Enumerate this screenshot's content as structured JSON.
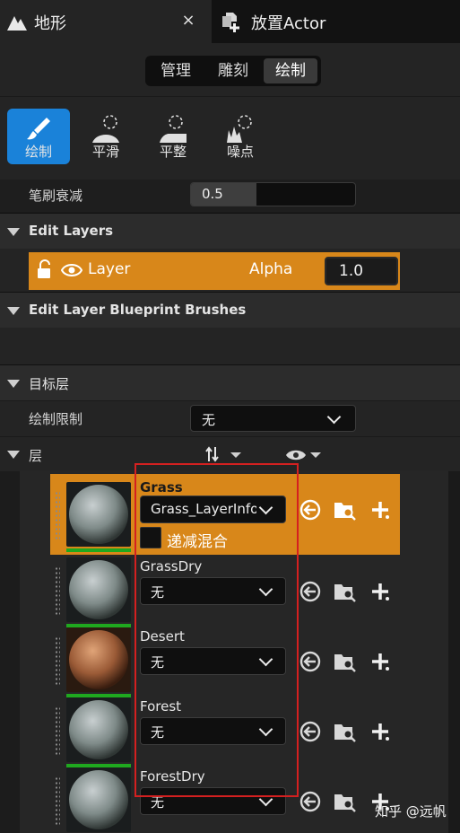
{
  "tabs": [
    {
      "title": "地形",
      "close": "×"
    },
    {
      "title": "放置Actor"
    }
  ],
  "modes": [
    "管理",
    "雕刻",
    "绘制"
  ],
  "active_mode": "绘制",
  "tools": [
    {
      "label": "绘制",
      "active": true
    },
    {
      "label": "平滑",
      "active": false
    },
    {
      "label": "平整",
      "active": false
    },
    {
      "label": "噪点",
      "active": false
    }
  ],
  "brush_falloff": {
    "label": "笔刷衰减",
    "value": "0.5",
    "fill": 0.4
  },
  "edit_layers": {
    "title": "Edit Layers",
    "layer_name": "Layer",
    "alpha_label": "Alpha",
    "alpha_value": "1.0"
  },
  "blueprint_brushes": {
    "title": "Edit Layer Blueprint Brushes"
  },
  "target_layers": {
    "title": "目标层",
    "paint_limit_label": "绘制限制",
    "paint_limit_value": "无",
    "layers_label": "层"
  },
  "layers": [
    {
      "name": "Grass",
      "dropdown": "Grass_LayerInfo",
      "blend_label": "递减混合",
      "active": true
    },
    {
      "name": "GrassDry",
      "dropdown": "无",
      "active": false
    },
    {
      "name": "Desert",
      "dropdown": "无",
      "active": false
    },
    {
      "name": "Forest",
      "dropdown": "无",
      "active": false
    },
    {
      "name": "ForestDry",
      "dropdown": "无",
      "active": false
    }
  ],
  "watermark": "知乎 @远帆",
  "colors": {
    "accent_blue": "#1a82d9",
    "layer_orange": "#d8871a",
    "highlight_red": "#d42020",
    "green": "#1fa81f"
  }
}
